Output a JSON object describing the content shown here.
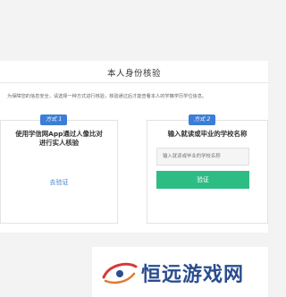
{
  "page": {
    "title": "本人身份核验",
    "notice": "为保障您的信息安全，请选择一种方式进行核验，核验通过后才能查看本人的学籍学历学位信息。"
  },
  "method1": {
    "badge": "方式 1",
    "title_line1": "使用学信网App通过人像比对",
    "title_line2": "进行实人核验",
    "action_label": "去验证"
  },
  "method2": {
    "badge": "方式 2",
    "title": "输入就读或毕业的学校名称",
    "input_value": "",
    "input_placeholder": "输入就读或毕业的学校名称",
    "button_label": "验证"
  },
  "watermark": {
    "text": "恒远游戏网"
  },
  "colors": {
    "accent_blue": "#3c7ed6",
    "button_green": "#2dbd84",
    "watermark_blue": "#2a4d8f"
  }
}
